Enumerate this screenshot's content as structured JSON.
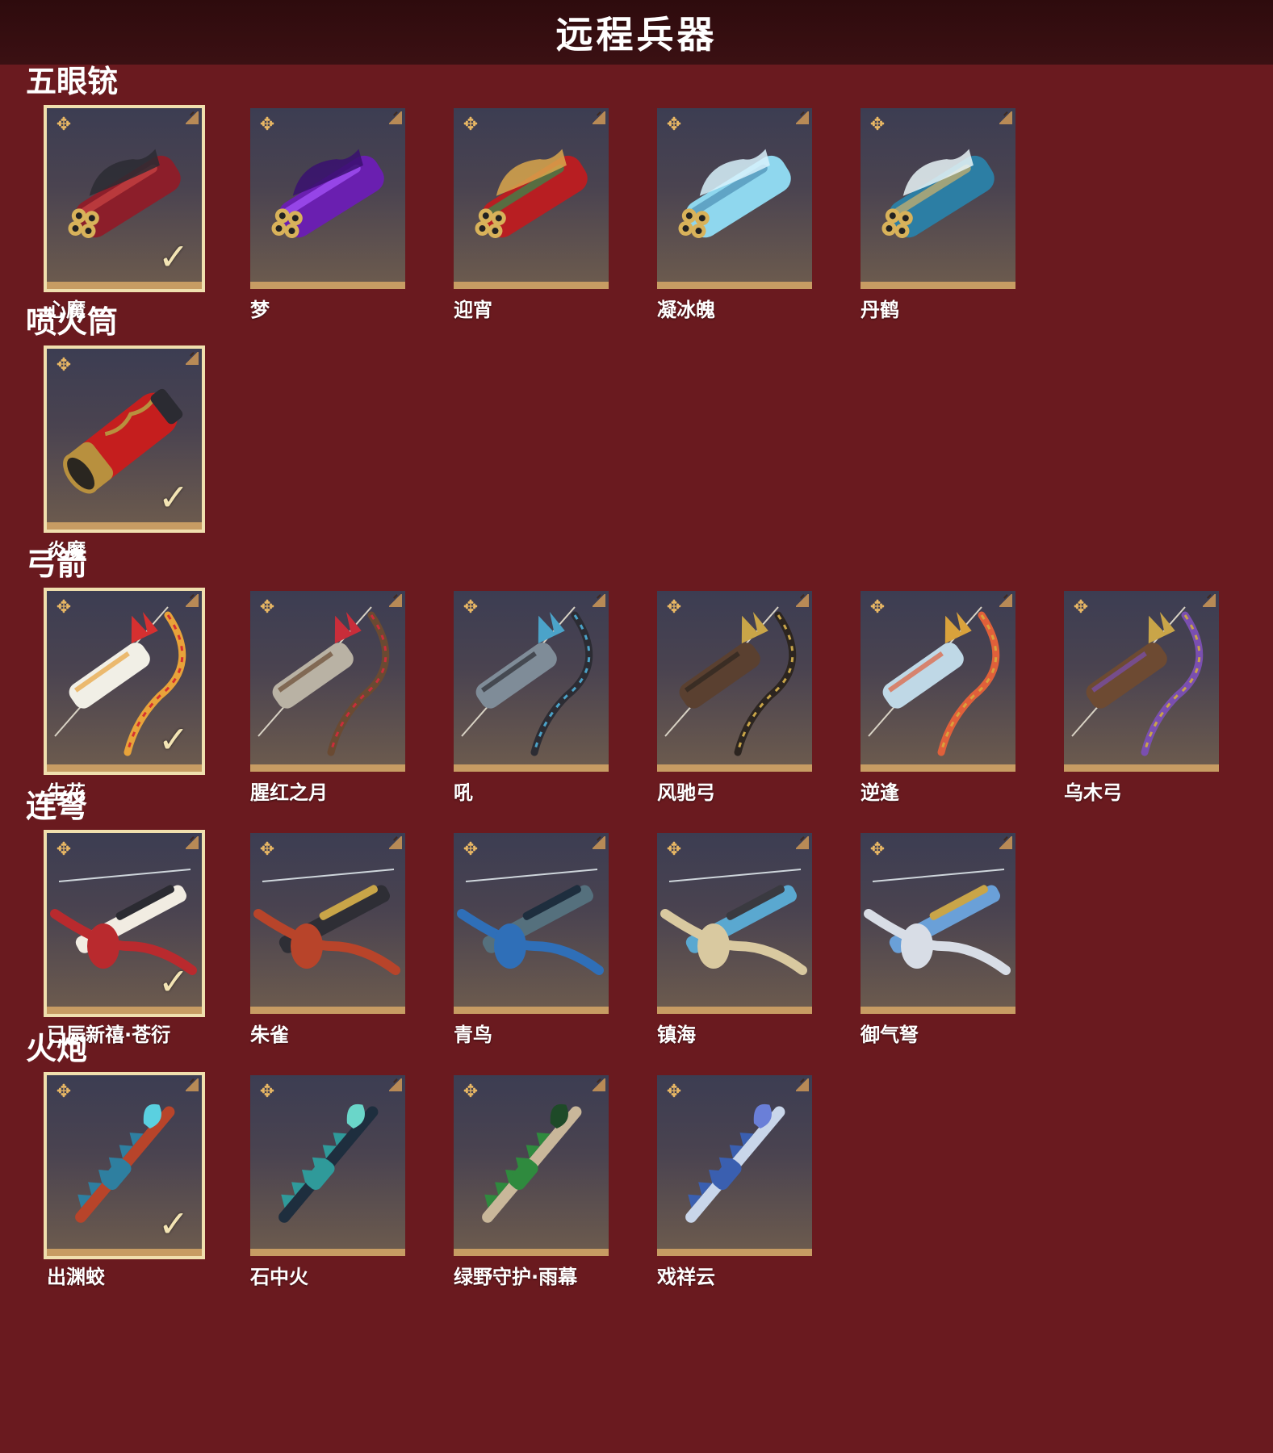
{
  "header": {
    "title": "远程兵器"
  },
  "sections": [
    {
      "title": "五眼铳",
      "items": [
        {
          "name": "心魔",
          "selected": true,
          "icon": "gun-icon",
          "colors": [
            "#8c1e2a",
            "#2b2b32",
            "#c44"
          ]
        },
        {
          "name": "梦",
          "selected": false,
          "icon": "gun-icon",
          "colors": [
            "#6a1fb0",
            "#3a1070",
            "#a955ff"
          ]
        },
        {
          "name": "迎宵",
          "selected": false,
          "icon": "gun-icon",
          "colors": [
            "#b81e22",
            "#d9a64b",
            "#2f8f4e"
          ]
        },
        {
          "name": "凝冰魄",
          "selected": false,
          "icon": "gun-icon",
          "colors": [
            "#8fd7ee",
            "#d8f2fb",
            "#4b8fb3"
          ]
        },
        {
          "name": "丹鹤",
          "selected": false,
          "icon": "gun-icon",
          "colors": [
            "#2c7ea4",
            "#e9f4f7",
            "#d2b36a"
          ]
        }
      ]
    },
    {
      "title": "喷火筒",
      "items": [
        {
          "name": "炎魔",
          "selected": true,
          "icon": "flamethrower-icon",
          "colors": [
            "#c51e1e",
            "#b8903e",
            "#2b2b32"
          ]
        }
      ]
    },
    {
      "title": "弓箭",
      "items": [
        {
          "name": "生花",
          "selected": true,
          "icon": "bow-icon",
          "colors": [
            "#f1efe6",
            "#d63030",
            "#e8a33a"
          ]
        },
        {
          "name": "腥红之月",
          "selected": false,
          "icon": "bow-icon",
          "colors": [
            "#b9b2a4",
            "#c92d3a",
            "#6a4a32"
          ]
        },
        {
          "name": "吼",
          "selected": false,
          "icon": "bow-icon",
          "colors": [
            "#7f8c98",
            "#4ba3c9",
            "#2c2c33"
          ]
        },
        {
          "name": "风驰弓",
          "selected": false,
          "icon": "bow-icon",
          "colors": [
            "#5a4030",
            "#c9a548",
            "#2c2520"
          ]
        },
        {
          "name": "逆逢",
          "selected": false,
          "icon": "bow-icon",
          "colors": [
            "#bfd8e6",
            "#d9a23c",
            "#e0603a"
          ]
        },
        {
          "name": "乌木弓",
          "selected": false,
          "icon": "bow-icon",
          "colors": [
            "#6d4a32",
            "#c9a548",
            "#7a4fb0"
          ]
        }
      ]
    },
    {
      "title": "连弩",
      "items": [
        {
          "name": "已辰新禧·苍衍",
          "selected": true,
          "icon": "crossbow-icon",
          "colors": [
            "#b92a2e",
            "#f1ece2",
            "#2b2b32"
          ]
        },
        {
          "name": "朱雀",
          "selected": false,
          "icon": "crossbow-icon",
          "colors": [
            "#b8442a",
            "#2e2e35",
            "#c9a548"
          ]
        },
        {
          "name": "青鸟",
          "selected": false,
          "icon": "crossbow-icon",
          "colors": [
            "#2f6fb8",
            "#55707d",
            "#1e2e3e"
          ]
        },
        {
          "name": "镇海",
          "selected": false,
          "icon": "crossbow-icon",
          "colors": [
            "#d9c9a0",
            "#5aa8d0",
            "#3a3a40"
          ]
        },
        {
          "name": "御气弩",
          "selected": false,
          "icon": "crossbow-icon",
          "colors": [
            "#d8dde6",
            "#6aa0d8",
            "#c9a548"
          ]
        }
      ]
    },
    {
      "title": "火炮",
      "items": [
        {
          "name": "出渊蛟",
          "selected": true,
          "icon": "cannon-staff-icon",
          "colors": [
            "#2e7fa0",
            "#b8442a",
            "#5ad0e0"
          ]
        },
        {
          "name": "石中火",
          "selected": false,
          "icon": "cannon-staff-icon",
          "colors": [
            "#2f9a9a",
            "#1e2e3e",
            "#6ad6c9"
          ]
        },
        {
          "name": "绿野守护·雨幕",
          "selected": false,
          "icon": "cannon-staff-icon",
          "colors": [
            "#2f8a3e",
            "#c9b79a",
            "#1e4a28"
          ]
        },
        {
          "name": "戏祥云",
          "selected": false,
          "icon": "cannon-staff-icon",
          "colors": [
            "#3a5fb0",
            "#c9d6ea",
            "#6a7fd8"
          ]
        }
      ]
    }
  ]
}
